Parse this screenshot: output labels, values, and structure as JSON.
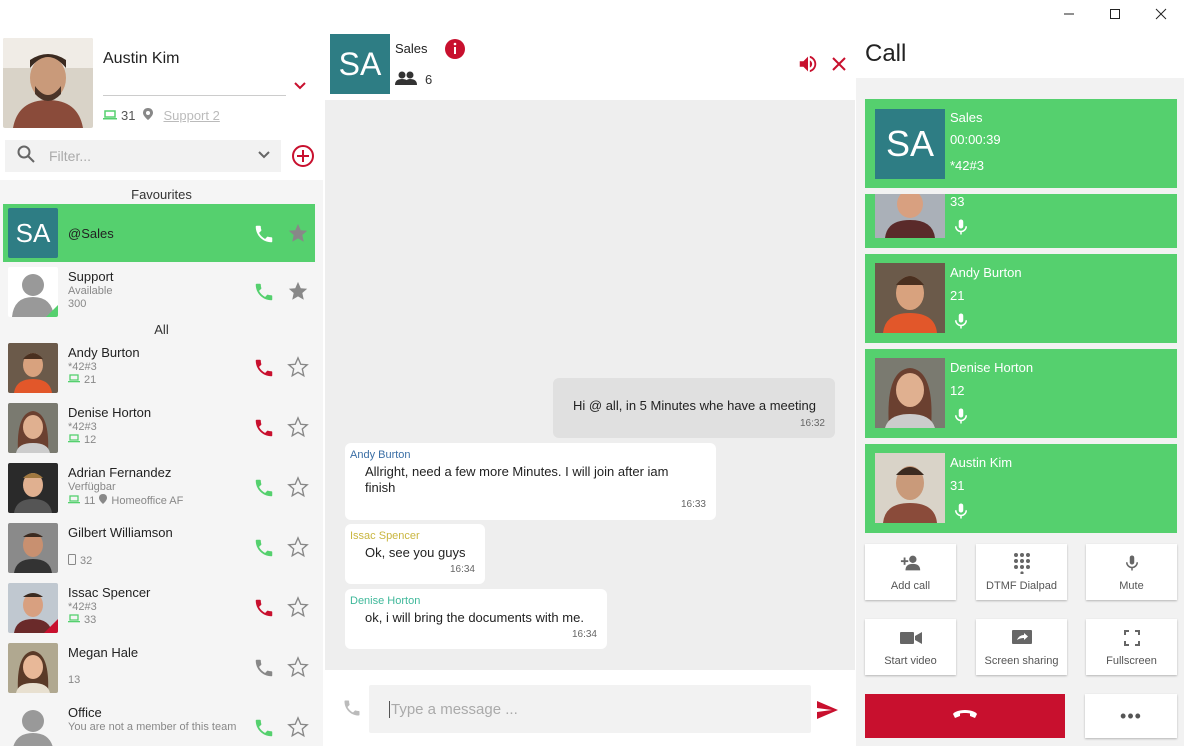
{
  "window": {
    "minimize": "—",
    "maximize": "☐",
    "close": "✕"
  },
  "profile": {
    "name": "Austin Kim",
    "device_count": "31",
    "location": "Support 2"
  },
  "filter": {
    "placeholder": "Filter..."
  },
  "list": {
    "favourites_label": "Favourites",
    "all_label": "All",
    "favourites": [
      {
        "initials": "SA",
        "name": "@Sales"
      },
      {
        "name": "Support",
        "status": "Available",
        "ext": "300"
      }
    ],
    "contacts": [
      {
        "name": "Andy Burton",
        "code": "*42#3",
        "ext": "21"
      },
      {
        "name": "Denise Horton",
        "code": "*42#3",
        "ext": "12"
      },
      {
        "name": "Adrian Fernandez",
        "status": "Verfügbar",
        "ext": "11",
        "location": "Homeoffice AF"
      },
      {
        "name": "Gilbert Williamson",
        "ext": "32"
      },
      {
        "name": "Issac Spencer",
        "code": "*42#3",
        "ext": "33"
      },
      {
        "name": "Megan Hale",
        "ext": "13"
      },
      {
        "name": "Office",
        "status": "You are not a member of this team"
      }
    ]
  },
  "chat": {
    "initials": "SA",
    "title": "Sales",
    "members": "6",
    "messages": [
      {
        "text": "Hi @ all, in 5 Minutes whe have a meeting",
        "time": "16:32"
      },
      {
        "author": "Andy Burton",
        "line1": "Allright, need a few more Minutes. I will join after iam",
        "line2": "finish",
        "time": "16:33"
      },
      {
        "author": "Issac Spencer",
        "text": "Ok, see you guys",
        "time": "16:34"
      },
      {
        "author": "Denise Horton",
        "text": "ok, i will bring the documents with me.",
        "time": "16:34"
      }
    ],
    "compose_placeholder": "Type a message ..."
  },
  "call": {
    "heading": "Call",
    "group": {
      "initials": "SA",
      "name": "Sales",
      "duration": "00:00:39",
      "code": "*42#3"
    },
    "participants": [
      {
        "name": "",
        "ext": "33"
      },
      {
        "name": "Andy Burton",
        "ext": "21"
      },
      {
        "name": "Denise Horton",
        "ext": "12"
      },
      {
        "name": "Austin Kim",
        "ext": "31"
      }
    ],
    "controls": {
      "add_call": "Add call",
      "dtmf": "DTMF Dialpad",
      "mute": "Mute",
      "video": "Start video",
      "screen": "Screen sharing",
      "fullscreen": "Fullscreen"
    },
    "more": "•••"
  },
  "colors": {
    "accent_red": "#c8102e",
    "accent_green": "#55d06e",
    "teal": "#2e7d84"
  },
  "icons": [
    "search-icon",
    "chevron-down-icon",
    "add-circle-icon",
    "phone-icon",
    "star-icon",
    "laptop-icon",
    "location-pin-icon",
    "group-icon",
    "info-icon",
    "speaker-icon",
    "close-icon",
    "send-icon",
    "mic-icon",
    "add-person-icon",
    "dialpad-icon",
    "video-icon",
    "screen-share-icon",
    "fullscreen-icon",
    "hangup-icon"
  ]
}
